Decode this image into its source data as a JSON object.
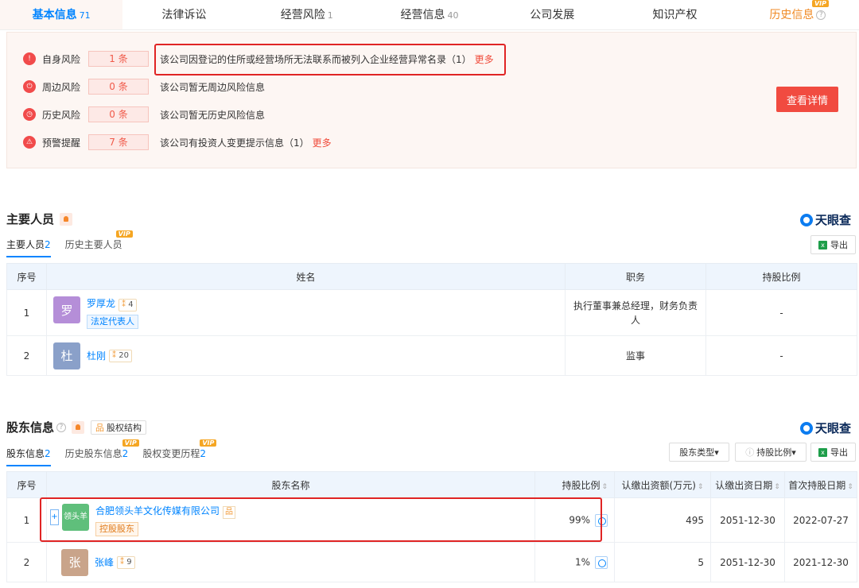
{
  "tabs": [
    {
      "label": "基本信息",
      "count": "71"
    },
    {
      "label": "法律诉讼",
      "count": ""
    },
    {
      "label": "经营风险",
      "count": "1"
    },
    {
      "label": "经营信息",
      "count": "40"
    },
    {
      "label": "公司发展",
      "count": ""
    },
    {
      "label": "知识产权",
      "count": ""
    },
    {
      "label": "历史信息",
      "count": ""
    }
  ],
  "vip_label": "VIP",
  "risk": {
    "rows": [
      {
        "label": "自身风险",
        "count": "1 条",
        "text": "该公司因登记的住所或经营场所无法联系而被列入企业经营异常名录（1）",
        "more": "更多"
      },
      {
        "label": "周边风险",
        "count": "0 条",
        "text": "该公司暂无周边风险信息",
        "more": ""
      },
      {
        "label": "历史风险",
        "count": "0 条",
        "text": "该公司暂无历史风险信息",
        "more": ""
      },
      {
        "label": "预警提醒",
        "count": "7 条",
        "text": "该公司有投资人变更提示信息（1）",
        "more": "更多"
      }
    ],
    "detail_button": "查看详情"
  },
  "brand": "天眼查",
  "staff": {
    "title": "主要人员",
    "subtabs": [
      {
        "label": "主要人员",
        "count": "2"
      },
      {
        "label": "历史主要人员",
        "count": ""
      }
    ],
    "export": "导出",
    "headers": [
      "序号",
      "姓名",
      "职务",
      "持股比例"
    ],
    "rows": [
      {
        "no": "1",
        "avatar": "罗",
        "name": "罗厚龙",
        "rel": "4",
        "tag": "法定代表人",
        "position": "执行董事兼总经理，财务负责人",
        "ratio": "-"
      },
      {
        "no": "2",
        "avatar": "杜",
        "name": "杜刚",
        "rel": "20",
        "tag": "",
        "position": "监事",
        "ratio": "-"
      }
    ]
  },
  "holders": {
    "title": "股东信息",
    "equity_btn": "股权结构",
    "subtabs": [
      {
        "label": "股东信息",
        "count": "2"
      },
      {
        "label": "历史股东信息",
        "count": "2"
      },
      {
        "label": "股权变更历程",
        "count": "2"
      }
    ],
    "filters": {
      "type": "股东类型",
      "ratio": "持股比例"
    },
    "export": "导出",
    "headers": [
      "序号",
      "股东名称",
      "持股比例",
      "认缴出资额(万元)",
      "认缴出资日期",
      "首次持股日期"
    ],
    "rows": [
      {
        "no": "1",
        "avatar": "领头羊",
        "name": "合肥领头羊文化传媒有限公司",
        "tag": "控股股东",
        "ratio": "99%",
        "amount": "495",
        "date": "2051-12-30",
        "first": "2022-07-27"
      },
      {
        "no": "2",
        "avatar": "张",
        "name": "张峰",
        "rel": "9",
        "ratio": "1%",
        "amount": "5",
        "date": "2051-12-30",
        "first": "2021-12-30"
      }
    ]
  },
  "colors": {
    "accent": "#0084ff",
    "danger": "#f14b40",
    "risk_bg": "#fdf6f3"
  }
}
